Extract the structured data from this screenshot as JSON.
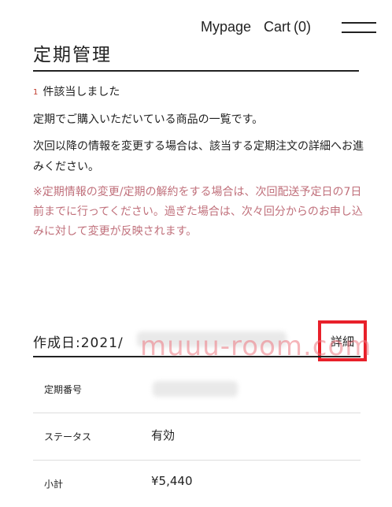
{
  "header": {
    "mypage_label": "Mypage",
    "cart_label": "Cart",
    "cart_count": "(0)",
    "menu_icon": "hamburger-menu-icon"
  },
  "page": {
    "title": "定期管理"
  },
  "results": {
    "count": "1",
    "text": "件該当しました"
  },
  "instructions": {
    "line1": "定期でご購入いただいている商品の一覧です。",
    "line2": "次回以降の情報を変更する場合は、該当する定期注文の詳細へお進みください。",
    "warning": "※定期情報の変更/定期の解約をする場合は、次回配送予定日の7日前までに行ってください。過ぎた場合は、次々回分からのお申し込みに対して変更が反映されます。"
  },
  "order": {
    "created_label": "作成日:2021/",
    "details_label": "詳細",
    "rows": [
      {
        "label": "定期番号",
        "value": ""
      },
      {
        "label": "ステータス",
        "value": "有効"
      },
      {
        "label": "小計",
        "value": "¥5,440"
      }
    ]
  },
  "colors": {
    "warning_text": "#c0707b",
    "highlight_border": "#e8202a",
    "count_accent": "#c0392b"
  },
  "watermark": {
    "text": "muuu-room.com"
  }
}
